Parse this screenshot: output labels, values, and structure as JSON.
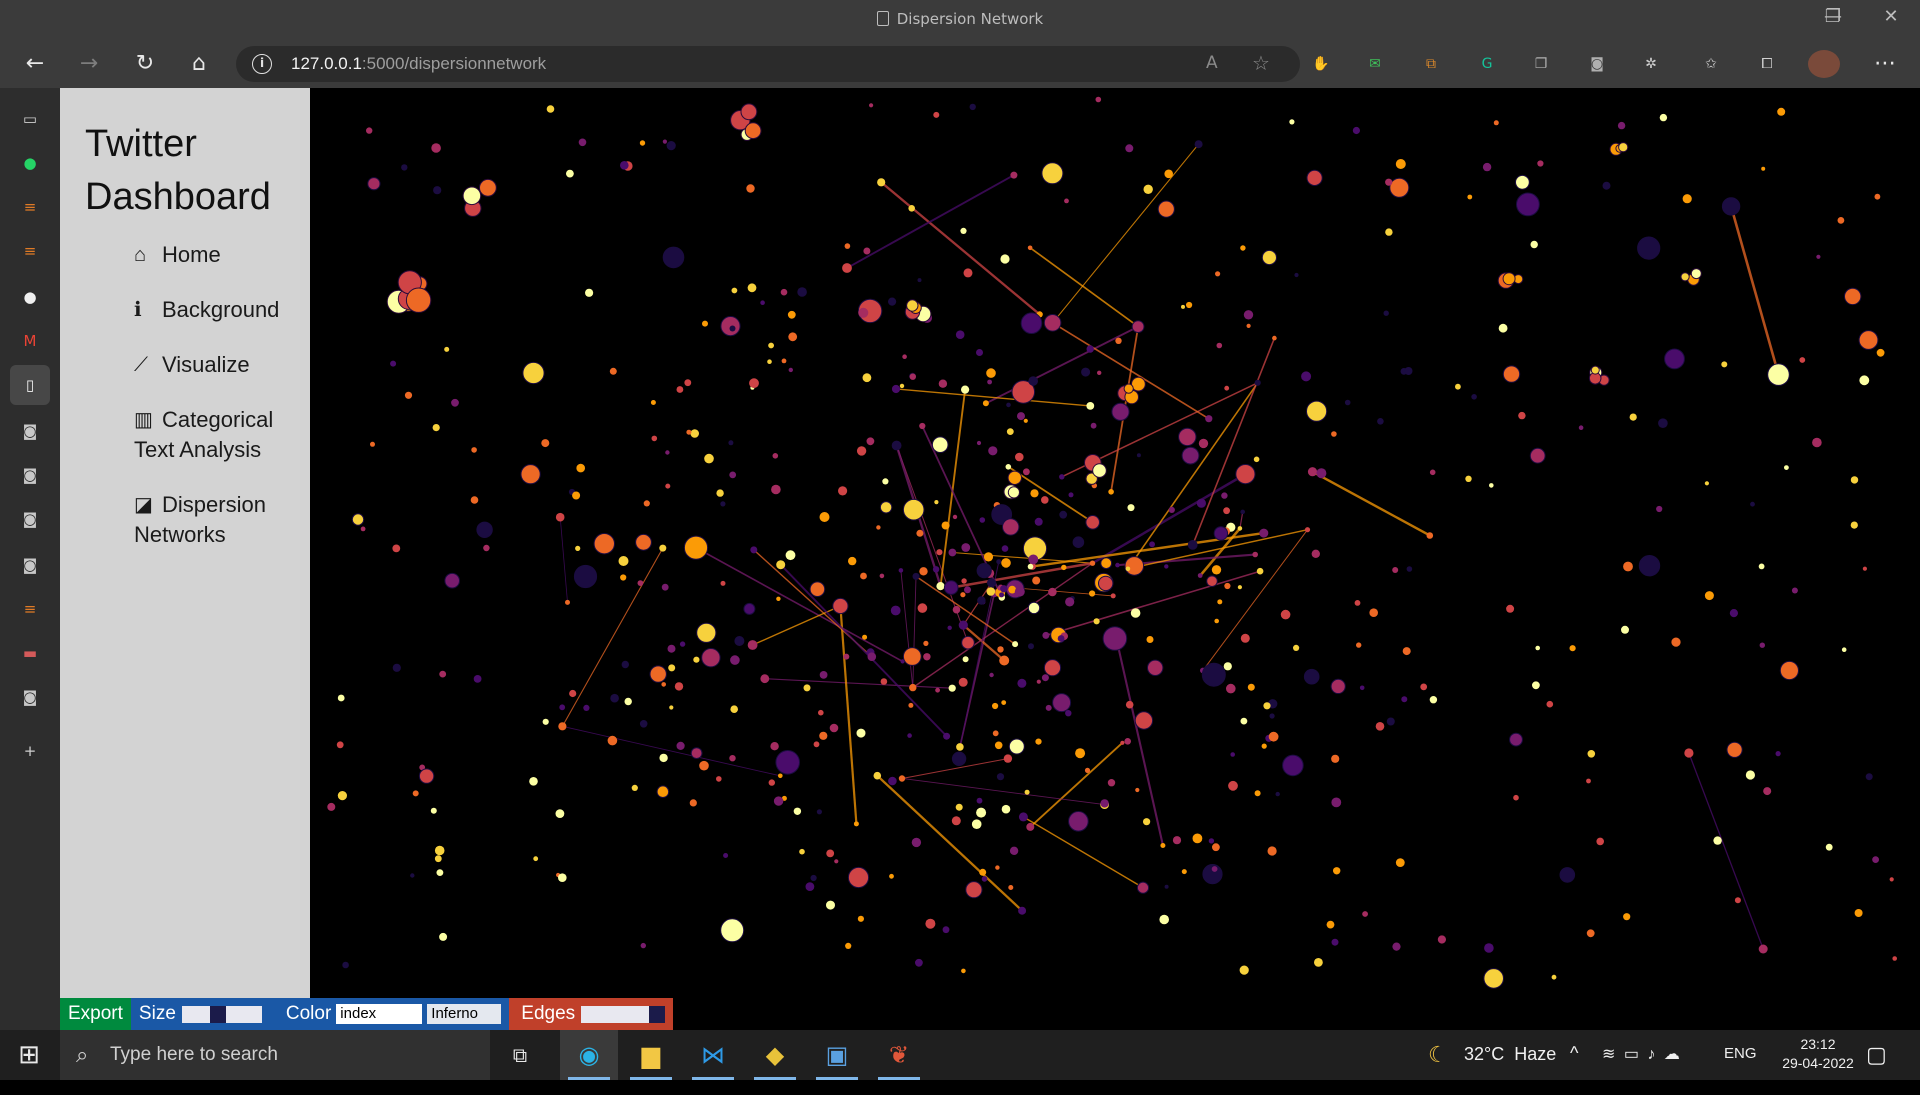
{
  "window": {
    "title": "Dispersion Network",
    "minimize_glyph": "—",
    "restore_glyph": "❐",
    "close_glyph": "✕"
  },
  "browser": {
    "url_host": "127.0.0.1",
    "url_path": ":5000/dispersionnetwork",
    "back_glyph": "←",
    "forward_glyph": "→",
    "refresh_glyph": "↻",
    "home_glyph": "⌂",
    "info_glyph": "i",
    "read_aloud_glyph": "A",
    "favorite_glyph": "☆",
    "menu_glyph": "⋯",
    "extensions": [
      {
        "name": "ext-hand-icon",
        "glyph": "✋",
        "color": "#d0d0d0"
      },
      {
        "name": "ext-mail-icon",
        "glyph": "✉",
        "color": "#3fbf5a"
      },
      {
        "name": "ext-crop-icon",
        "glyph": "⧉",
        "color": "#e08b2a"
      },
      {
        "name": "grammarly-icon",
        "glyph": "G",
        "color": "#15c39a"
      },
      {
        "name": "ext-copy-icon",
        "glyph": "❐",
        "color": "#b0b0b0"
      },
      {
        "name": "ext-camera-icon",
        "glyph": "◙",
        "color": "#b0b0b0"
      },
      {
        "name": "extensions-icon",
        "glyph": "✲",
        "color": "#d0d0d0"
      },
      {
        "name": "favorites-icon",
        "glyph": "✩",
        "color": "#d0d0d0"
      },
      {
        "name": "collections-icon",
        "glyph": "⧠",
        "color": "#d0d0d0"
      }
    ]
  },
  "vertical_tabs": [
    {
      "name": "tab-actions-icon",
      "glyph": "▭",
      "color": "#d0d0d0"
    },
    {
      "name": "whatsapp-icon",
      "glyph": "●",
      "color": "#25d366"
    },
    {
      "name": "stackoverflow-icon",
      "glyph": "≡",
      "color": "#e07b26"
    },
    {
      "name": "stackoverflow-icon-2",
      "glyph": "≡",
      "color": "#e07b26"
    },
    {
      "name": "github-icon",
      "glyph": "●",
      "color": "#f0f0f0"
    },
    {
      "name": "gmail-icon",
      "glyph": "M",
      "color": "#ea4335"
    },
    {
      "name": "document-icon",
      "glyph": "▯",
      "color": "#f0f0f0"
    },
    {
      "name": "camera-icon-1",
      "glyph": "◙",
      "color": "#c8c8c8"
    },
    {
      "name": "camera-icon-2",
      "glyph": "◙",
      "color": "#c8c8c8"
    },
    {
      "name": "camera-icon-3",
      "glyph": "◙",
      "color": "#c8c8c8"
    },
    {
      "name": "camera-icon-4",
      "glyph": "◙",
      "color": "#c8c8c8"
    },
    {
      "name": "stackoverflow-icon-3",
      "glyph": "≡",
      "color": "#e07b26"
    },
    {
      "name": "app-icon",
      "glyph": "▬",
      "color": "#d45a5a"
    },
    {
      "name": "camera-icon-5",
      "glyph": "◙",
      "color": "#c8c8c8"
    },
    {
      "name": "new-tab-icon",
      "glyph": "+",
      "color": "#d0d0d0"
    }
  ],
  "sidebar": {
    "brand_line1": "Twitter",
    "brand_line2": "Dashboard",
    "items": [
      {
        "icon": "home-icon",
        "glyph": "⌂",
        "line1": "Home",
        "line2": ""
      },
      {
        "icon": "info-icon",
        "glyph": "ℹ",
        "line1": "Background",
        "line2": ""
      },
      {
        "icon": "line-chart-icon",
        "glyph": "⟋",
        "line1": "Visualize",
        "line2": ""
      },
      {
        "icon": "bar-chart-icon",
        "glyph": "▥",
        "line1": "Categorical",
        "line2": "Text Analysis"
      },
      {
        "icon": "external-link-icon",
        "glyph": "◪",
        "line1": "Dispersion",
        "line2": "Networks"
      }
    ]
  },
  "controls": {
    "export_label": "Export",
    "size_label": "Size",
    "color_label": "Color",
    "color_field_value": "index",
    "colormap_value": "Inferno",
    "edges_label": "Edges",
    "colors": {
      "export_bg": "#008a3e",
      "size_bg": "#1a58a6",
      "color_bg": "#1a58a6",
      "edges_bg": "#c0402a"
    }
  },
  "palette": [
    "#1b0c41",
    "#4a0c6b",
    "#781c6d",
    "#a52c60",
    "#cf4446",
    "#ed6925",
    "#fb9b06",
    "#f7d13d",
    "#fcffa4"
  ],
  "taskbar": {
    "start_glyph": "⊞",
    "search_placeholder": "Type here to search",
    "search_glyph": "⌕",
    "task_view_glyph": "⧉",
    "apps": [
      {
        "name": "edge-icon",
        "glyph": "◉",
        "color": "#2bb3e6"
      },
      {
        "name": "file-explorer-icon",
        "glyph": "▆",
        "color": "#f2c744"
      },
      {
        "name": "vscode-icon",
        "glyph": "⋈",
        "color": "#2e9ae6"
      },
      {
        "name": "git-icon",
        "glyph": "◆",
        "color": "#e8c23a"
      },
      {
        "name": "photos-icon",
        "glyph": "▣",
        "color": "#5aa0e0"
      },
      {
        "name": "app-icon",
        "glyph": "❦",
        "color": "#e0573a"
      }
    ],
    "weather_glyph": "☾",
    "weather_text": "32°C  Haze",
    "tray_up_glyph": "^",
    "tray_glyphs": "≋ ▭ ♪ ☁",
    "language": "ENG",
    "time": "23:12",
    "date": "29-04-2022",
    "notification_glyph": "▢"
  }
}
